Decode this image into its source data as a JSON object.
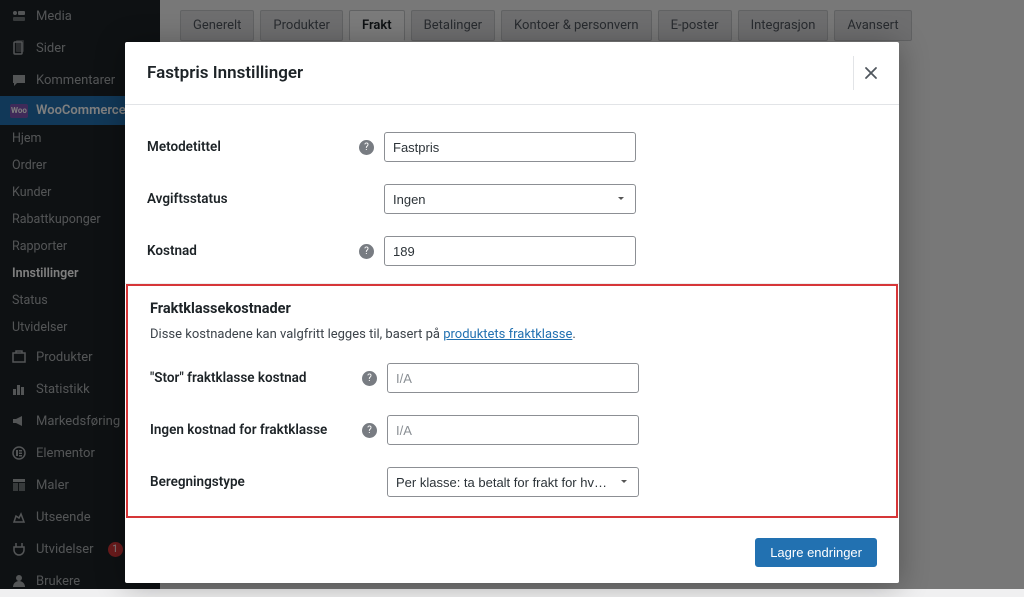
{
  "sidebar": {
    "media": "Media",
    "sider": "Sider",
    "kommentarer": "Kommentarer",
    "woocommerce": "WooCommerce",
    "sub": {
      "hjem": "Hjem",
      "ordrer": "Ordrer",
      "kunder": "Kunder",
      "rabattkuponger": "Rabattkuponger",
      "rapporter": "Rapporter",
      "innstillinger": "Innstillinger",
      "status": "Status",
      "utvidelser": "Utvidelser"
    },
    "produkter": "Produkter",
    "statistikk": "Statistikk",
    "markedsforing": "Markedsføring",
    "elementor": "Elementor",
    "maler": "Maler",
    "utseende": "Utseende",
    "utvidelser2": "Utvidelser",
    "utvidelser2_badge": "1",
    "brukere": "Brukere"
  },
  "tabs": {
    "generelt": "Generelt",
    "produkter": "Produkter",
    "frakt": "Frakt",
    "betalinger": "Betalinger",
    "kontoer": "Kontoer & personvern",
    "eposter": "E-poster",
    "integrasjon": "Integrasjon",
    "avansert": "Avansert"
  },
  "modal": {
    "title": "Fastpris Innstillinger",
    "fields": {
      "metodetittel_label": "Metodetittel",
      "metodetittel_value": "Fastpris",
      "avgiftstatus_label": "Avgiftsstatus",
      "avgiftstatus_value": "Ingen",
      "kostnad_label": "Kostnad",
      "kostnad_value": "189",
      "section_heading": "Fraktklassekostnader",
      "section_desc_pre": "Disse kostnadene kan valgfritt legges til, basert på ",
      "section_desc_link": "produktets fraktklasse",
      "stor_label": "\"Stor\" fraktklasse kostnad",
      "stor_placeholder": "I/A",
      "ingen_label": "Ingen kostnad for fraktklasse",
      "ingen_placeholder": "I/A",
      "beregning_label": "Beregningstype",
      "beregning_value": "Per klasse: ta betalt for frakt for hver fraktklasse individuelt"
    },
    "save_button": "Lagre endringer"
  }
}
